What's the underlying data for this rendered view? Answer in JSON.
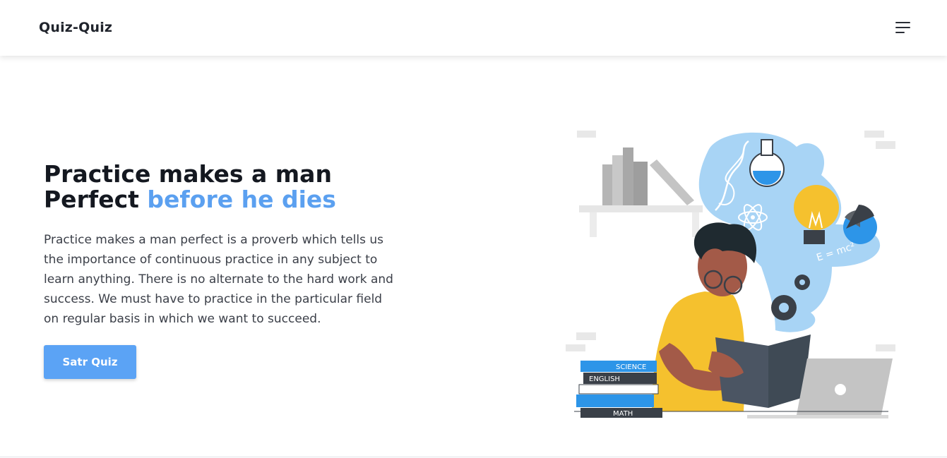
{
  "header": {
    "brand": "Quiz-Quiz",
    "menu_icon": "hamburger-menu-icon"
  },
  "hero": {
    "title_line1": "Practice makes a man",
    "title_line2_plain": "Perfect",
    "title_line2_accent": "before he dies",
    "description": "Practice makes a man perfect is a proverb which tells us the importance of continuous practice in any subject to learn anything. There is no alternate to the hard work and success. We must have to practice in the particular field on regular basis in which we want to succeed.",
    "cta_label": "Satr Quiz"
  },
  "illustration": {
    "book_labels": [
      "SCIENCE",
      "ENGLISH",
      "MATH"
    ],
    "formula": "E = mc²"
  },
  "colors": {
    "accent": "#5ba0f0",
    "button": "#5ba3f5",
    "cloud": "#a8d4f5",
    "shirt": "#f5c12e",
    "skin": "#a35a48"
  }
}
